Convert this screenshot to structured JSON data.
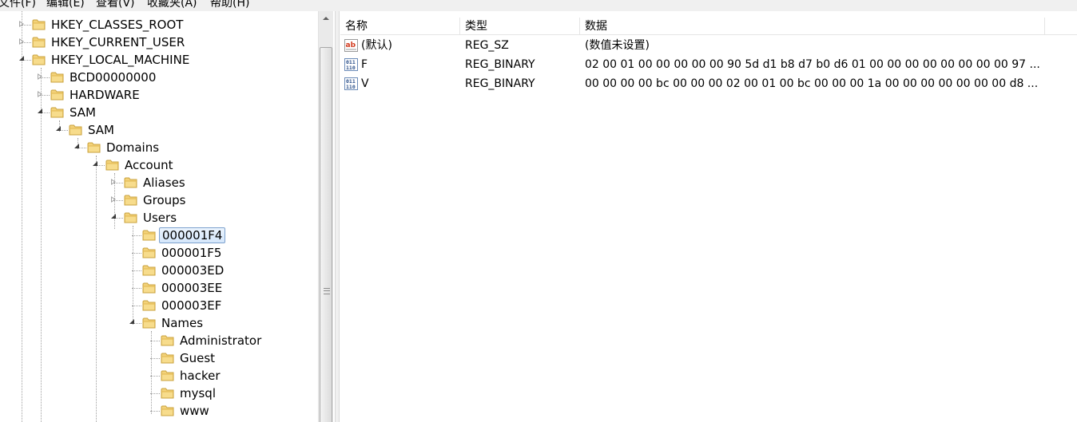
{
  "menu": {
    "items": [
      "文件(F)",
      "编辑(E)",
      "查看(V)",
      "收藏夹(A)",
      "帮助(H)"
    ]
  },
  "tree": {
    "nodes": [
      {
        "label": "HKEY_CLASSES_ROOT",
        "state": "collapsed"
      },
      {
        "label": "HKEY_CURRENT_USER",
        "state": "collapsed"
      },
      {
        "label": "HKEY_LOCAL_MACHINE",
        "state": "expanded"
      },
      {
        "label": "BCD00000000",
        "state": "collapsed"
      },
      {
        "label": "HARDWARE",
        "state": "collapsed"
      },
      {
        "label": "SAM",
        "state": "expanded"
      },
      {
        "label": "SAM",
        "state": "expanded"
      },
      {
        "label": "Domains",
        "state": "expanded"
      },
      {
        "label": "Account",
        "state": "expanded"
      },
      {
        "label": "Aliases",
        "state": "collapsed"
      },
      {
        "label": "Groups",
        "state": "collapsed"
      },
      {
        "label": "Users",
        "state": "expanded"
      },
      {
        "label": "000001F4",
        "state": "leaf",
        "selected": true
      },
      {
        "label": "000001F5",
        "state": "leaf"
      },
      {
        "label": "000003ED",
        "state": "leaf"
      },
      {
        "label": "000003EE",
        "state": "leaf"
      },
      {
        "label": "000003EF",
        "state": "leaf"
      },
      {
        "label": "Names",
        "state": "expanded"
      },
      {
        "label": "Administrator",
        "state": "leaf"
      },
      {
        "label": "Guest",
        "state": "leaf"
      },
      {
        "label": "hacker",
        "state": "leaf"
      },
      {
        "label": "mysql",
        "state": "leaf"
      },
      {
        "label": "www",
        "state": "leaf"
      }
    ]
  },
  "list": {
    "columns": {
      "name": "名称",
      "type": "类型",
      "data": "数据"
    },
    "rows": [
      {
        "name": "(默认)",
        "type": "REG_SZ",
        "data": "(数值未设置)",
        "icon": "string-value-icon"
      },
      {
        "name": "F",
        "type": "REG_BINARY",
        "data": "02 00 01 00 00 00 00 00 90 5d d1 b8 d7 b0 d6 01 00 00 00 00 00 00 00 00 97 ...",
        "icon": "binary-value-icon"
      },
      {
        "name": "V",
        "type": "REG_BINARY",
        "data": "00 00 00 00 bc 00 00 00 02 00 01 00 bc 00 00 00 1a 00 00 00 00 00 00 00 d8 ...",
        "icon": "binary-value-icon"
      }
    ]
  },
  "colors": {
    "folder": "#e8c45a",
    "selection_border": "#7da2ce",
    "selection_fill": "#dce9fa"
  }
}
